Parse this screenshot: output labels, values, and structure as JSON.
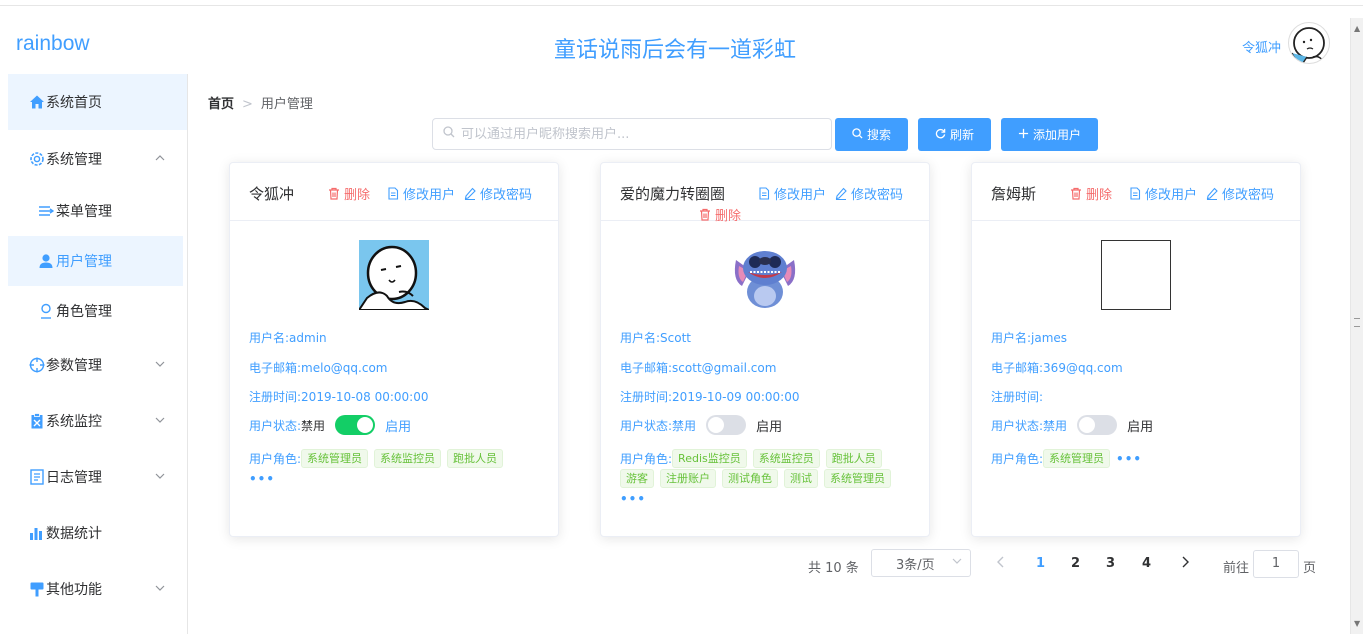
{
  "header": {
    "logo": "rainbow",
    "slogan": "童话说雨后会有一道彩虹",
    "user_name": "令狐冲",
    "avatar_icon": "sketch-face-avatar"
  },
  "sidebar": {
    "items": [
      {
        "label": "系统首页",
        "icon": "home-icon"
      },
      {
        "label": "系统管理",
        "icon": "gear-icon",
        "expanded": true
      },
      {
        "label": "菜单管理",
        "icon": "menu-icon"
      },
      {
        "label": "用户管理",
        "icon": "user-icon",
        "active": true
      },
      {
        "label": "角色管理",
        "icon": "role-icon"
      },
      {
        "label": "参数管理",
        "icon": "crosshair-icon"
      },
      {
        "label": "系统监控",
        "icon": "clipboard-icon"
      },
      {
        "label": "日志管理",
        "icon": "log-icon"
      },
      {
        "label": "数据统计",
        "icon": "bar-chart-icon"
      },
      {
        "label": "其他功能",
        "icon": "sign-icon"
      }
    ]
  },
  "breadcrumb": {
    "home": "首页",
    "current": "用户管理"
  },
  "search": {
    "placeholder": "可以通过用户昵称搜索用户..."
  },
  "toolbar": {
    "search_label": "搜索",
    "refresh_label": "刷新",
    "add_label": "添加用户"
  },
  "card_labels": {
    "delete": "删除",
    "edit_user": "修改用户",
    "edit_password": "修改密码",
    "username": "用户名:",
    "email": "电子邮箱:",
    "register": "注册时间:",
    "status": "用户状态:",
    "disabled": "禁用",
    "enabled": "启用",
    "roles": "用户角色:",
    "more": "•••"
  },
  "cards": [
    {
      "title": "令狐冲",
      "username": "admin",
      "email": "melo@qq.com",
      "register_time": "2019-10-08 00:00:00",
      "status_enabled": true,
      "roles": [
        "系统管理员",
        "系统监控员",
        "跑批人员"
      ]
    },
    {
      "title": "爱的魔力转圈圈",
      "username": "Scott",
      "email": "scott@gmail.com",
      "register_time": "2019-10-09 00:00:00",
      "status_enabled": false,
      "roles": [
        "Redis监控员",
        "系统监控员",
        "跑批人员",
        "游客",
        "注册账户",
        "测试角色",
        "测试",
        "系统管理员"
      ]
    },
    {
      "title": "詹姆斯",
      "username": "james",
      "email": "369@qq.com",
      "register_time": "",
      "status_enabled": false,
      "roles": [
        "系统管理员"
      ]
    }
  ],
  "pagination": {
    "total": "共 10 条",
    "page_size": "3条/页",
    "pages": [
      "1",
      "2",
      "3",
      "4"
    ],
    "current": "1",
    "goto_label": "前往",
    "goto_value": "1",
    "page_suffix": "页"
  },
  "colors": {
    "primary": "#409eff",
    "danger": "#f56c6c",
    "success": "#13ce66",
    "tag_green": "#67c23a"
  }
}
